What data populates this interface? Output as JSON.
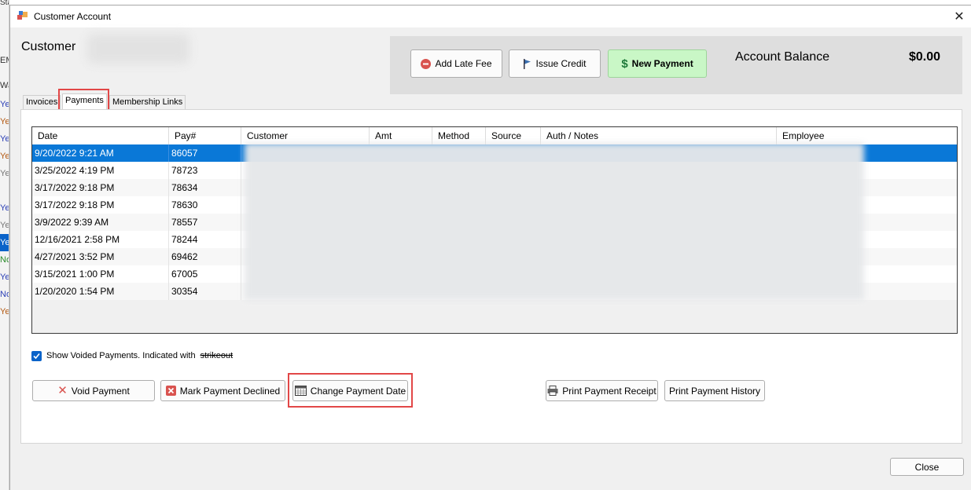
{
  "background_app": {
    "top_label": "Start",
    "column_cells": [
      "EMA",
      "Wa",
      "Yes",
      "Yes",
      "Yes",
      "Yes",
      "Yes",
      "Yes",
      "Yes",
      "Yes",
      "No",
      "Yes",
      "No",
      "Yes"
    ]
  },
  "window": {
    "title": "Customer Account",
    "customer_label": "Customer"
  },
  "actions": {
    "add_late_fee": "Add Late Fee",
    "issue_credit": "Issue Credit",
    "new_payment": "New Payment"
  },
  "balance": {
    "label": "Account Balance",
    "value": "$0.00"
  },
  "tabs": [
    {
      "label": "Invoices"
    },
    {
      "label": "Payments"
    },
    {
      "label": "Membership Links"
    }
  ],
  "grid": {
    "columns": [
      "Date",
      "Pay#",
      "Customer",
      "Amt",
      "Method",
      "Source",
      "Auth / Notes",
      "Employee"
    ],
    "rows": [
      {
        "date": "9/20/2022 9:21 AM",
        "pay": "86057"
      },
      {
        "date": "3/25/2022 4:19 PM",
        "pay": "78723"
      },
      {
        "date": "3/17/2022 9:18 PM",
        "pay": "78634"
      },
      {
        "date": "3/17/2022 9:18 PM",
        "pay": "78630"
      },
      {
        "date": "3/9/2022 9:39 AM",
        "pay": "78557"
      },
      {
        "date": "12/16/2021 2:58 PM",
        "pay": "78244"
      },
      {
        "date": "4/27/2021 3:52 PM",
        "pay": "69462"
      },
      {
        "date": "3/15/2021 1:00 PM",
        "pay": "67005"
      },
      {
        "date": "1/20/2020 1:54 PM",
        "pay": "30354"
      }
    ]
  },
  "voided": {
    "label": "Show Voided Payments. Indicated with",
    "strike_word": "strikeout",
    "checked": true
  },
  "buttons": {
    "void_payment": "Void Payment",
    "mark_declined": "Mark Payment Declined",
    "change_date": "Change Payment Date",
    "print_receipt": "Print Payment Receipt",
    "print_history": "Print Payment History",
    "close": "Close"
  },
  "colors": {
    "selected_row": "#0a78d7",
    "new_payment_bg": "#c9f7c6",
    "highlight_box": "#e24747"
  }
}
